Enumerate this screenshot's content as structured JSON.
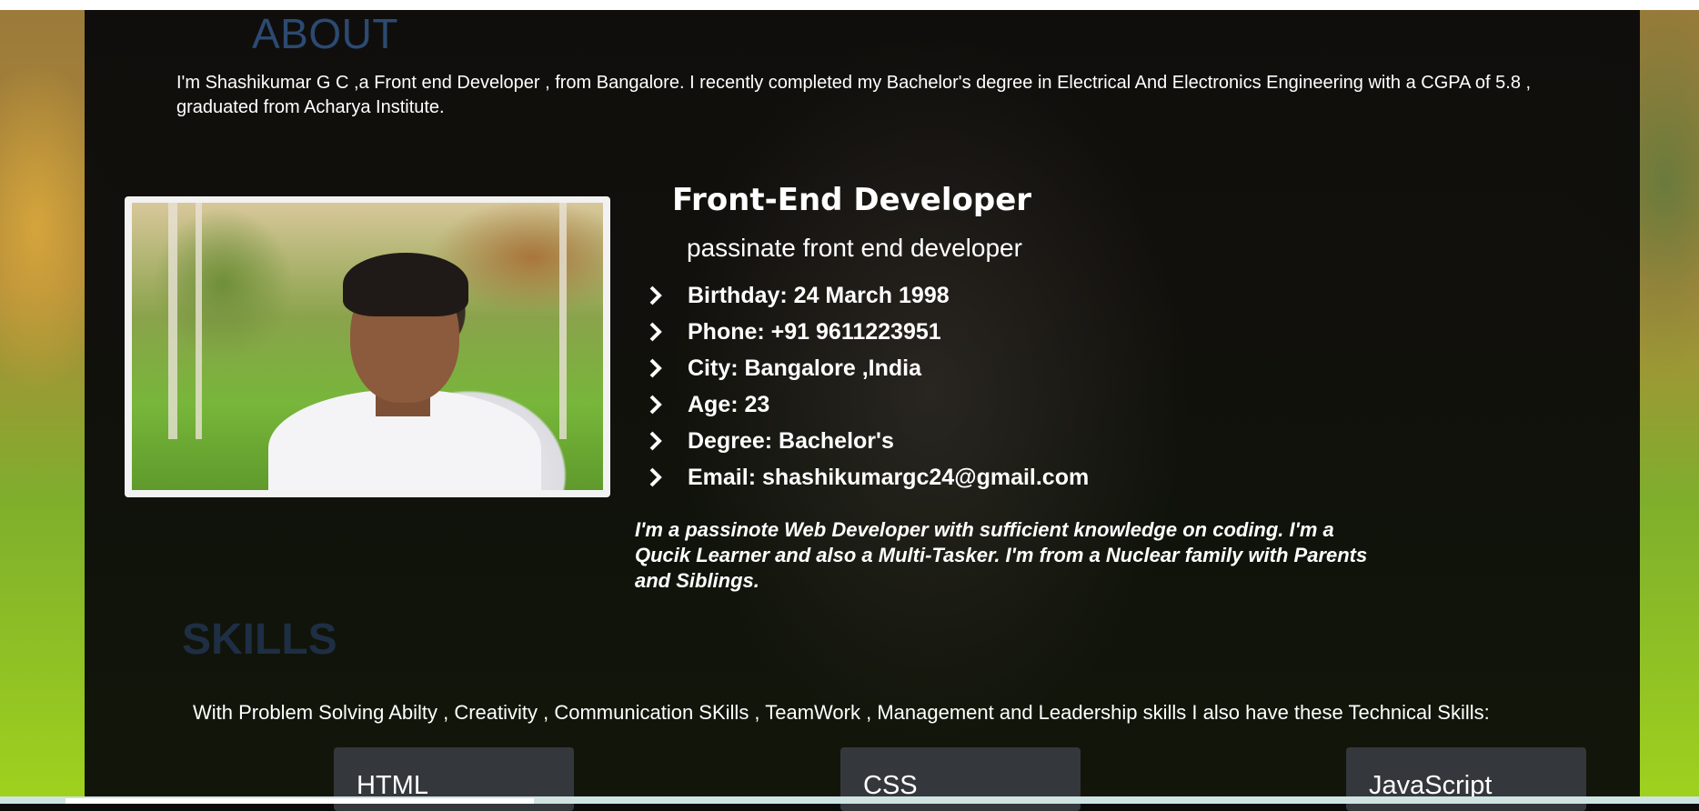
{
  "about": {
    "title": "ABOUT",
    "text": "I'm Shashikumar G C ,a Front end Developer , from Bangalore. I recently completed my Bachelor's degree in Electrical And Electronics Engineering with a CGPA of 5.8 , graduated from Acharya Institute."
  },
  "profile": {
    "role": "Front-End Developer",
    "tagline": "passinate front end developer",
    "facts": [
      "Birthday: 24 March 1998",
      "Phone: +91 9611223951",
      "City: Bangalore ,India",
      "Age: 23",
      "Degree: Bachelor's",
      "Email: shashikumargc24@gmail.com"
    ],
    "fact_icon": "chevron-right-icon",
    "bio": "I'm a passinote Web Developer with sufficient knowledge on coding. I'm a Qucik Learner and also a Multi-Tasker. I'm from a Nuclear family with Parents and Siblings."
  },
  "skills": {
    "title": "SKILLS",
    "intro": "With Problem Solving Abilty , Creativity , Communication SKills , TeamWork , Management and Leadership skills I also have these Technical Skills:",
    "items": [
      "HTML",
      "CSS",
      "JavaScript"
    ]
  },
  "colors": {
    "section_heading_about": "#2c4a72",
    "section_heading_skills": "#1e2e44",
    "card_bg": "#34373b",
    "text": "#ffffff"
  }
}
